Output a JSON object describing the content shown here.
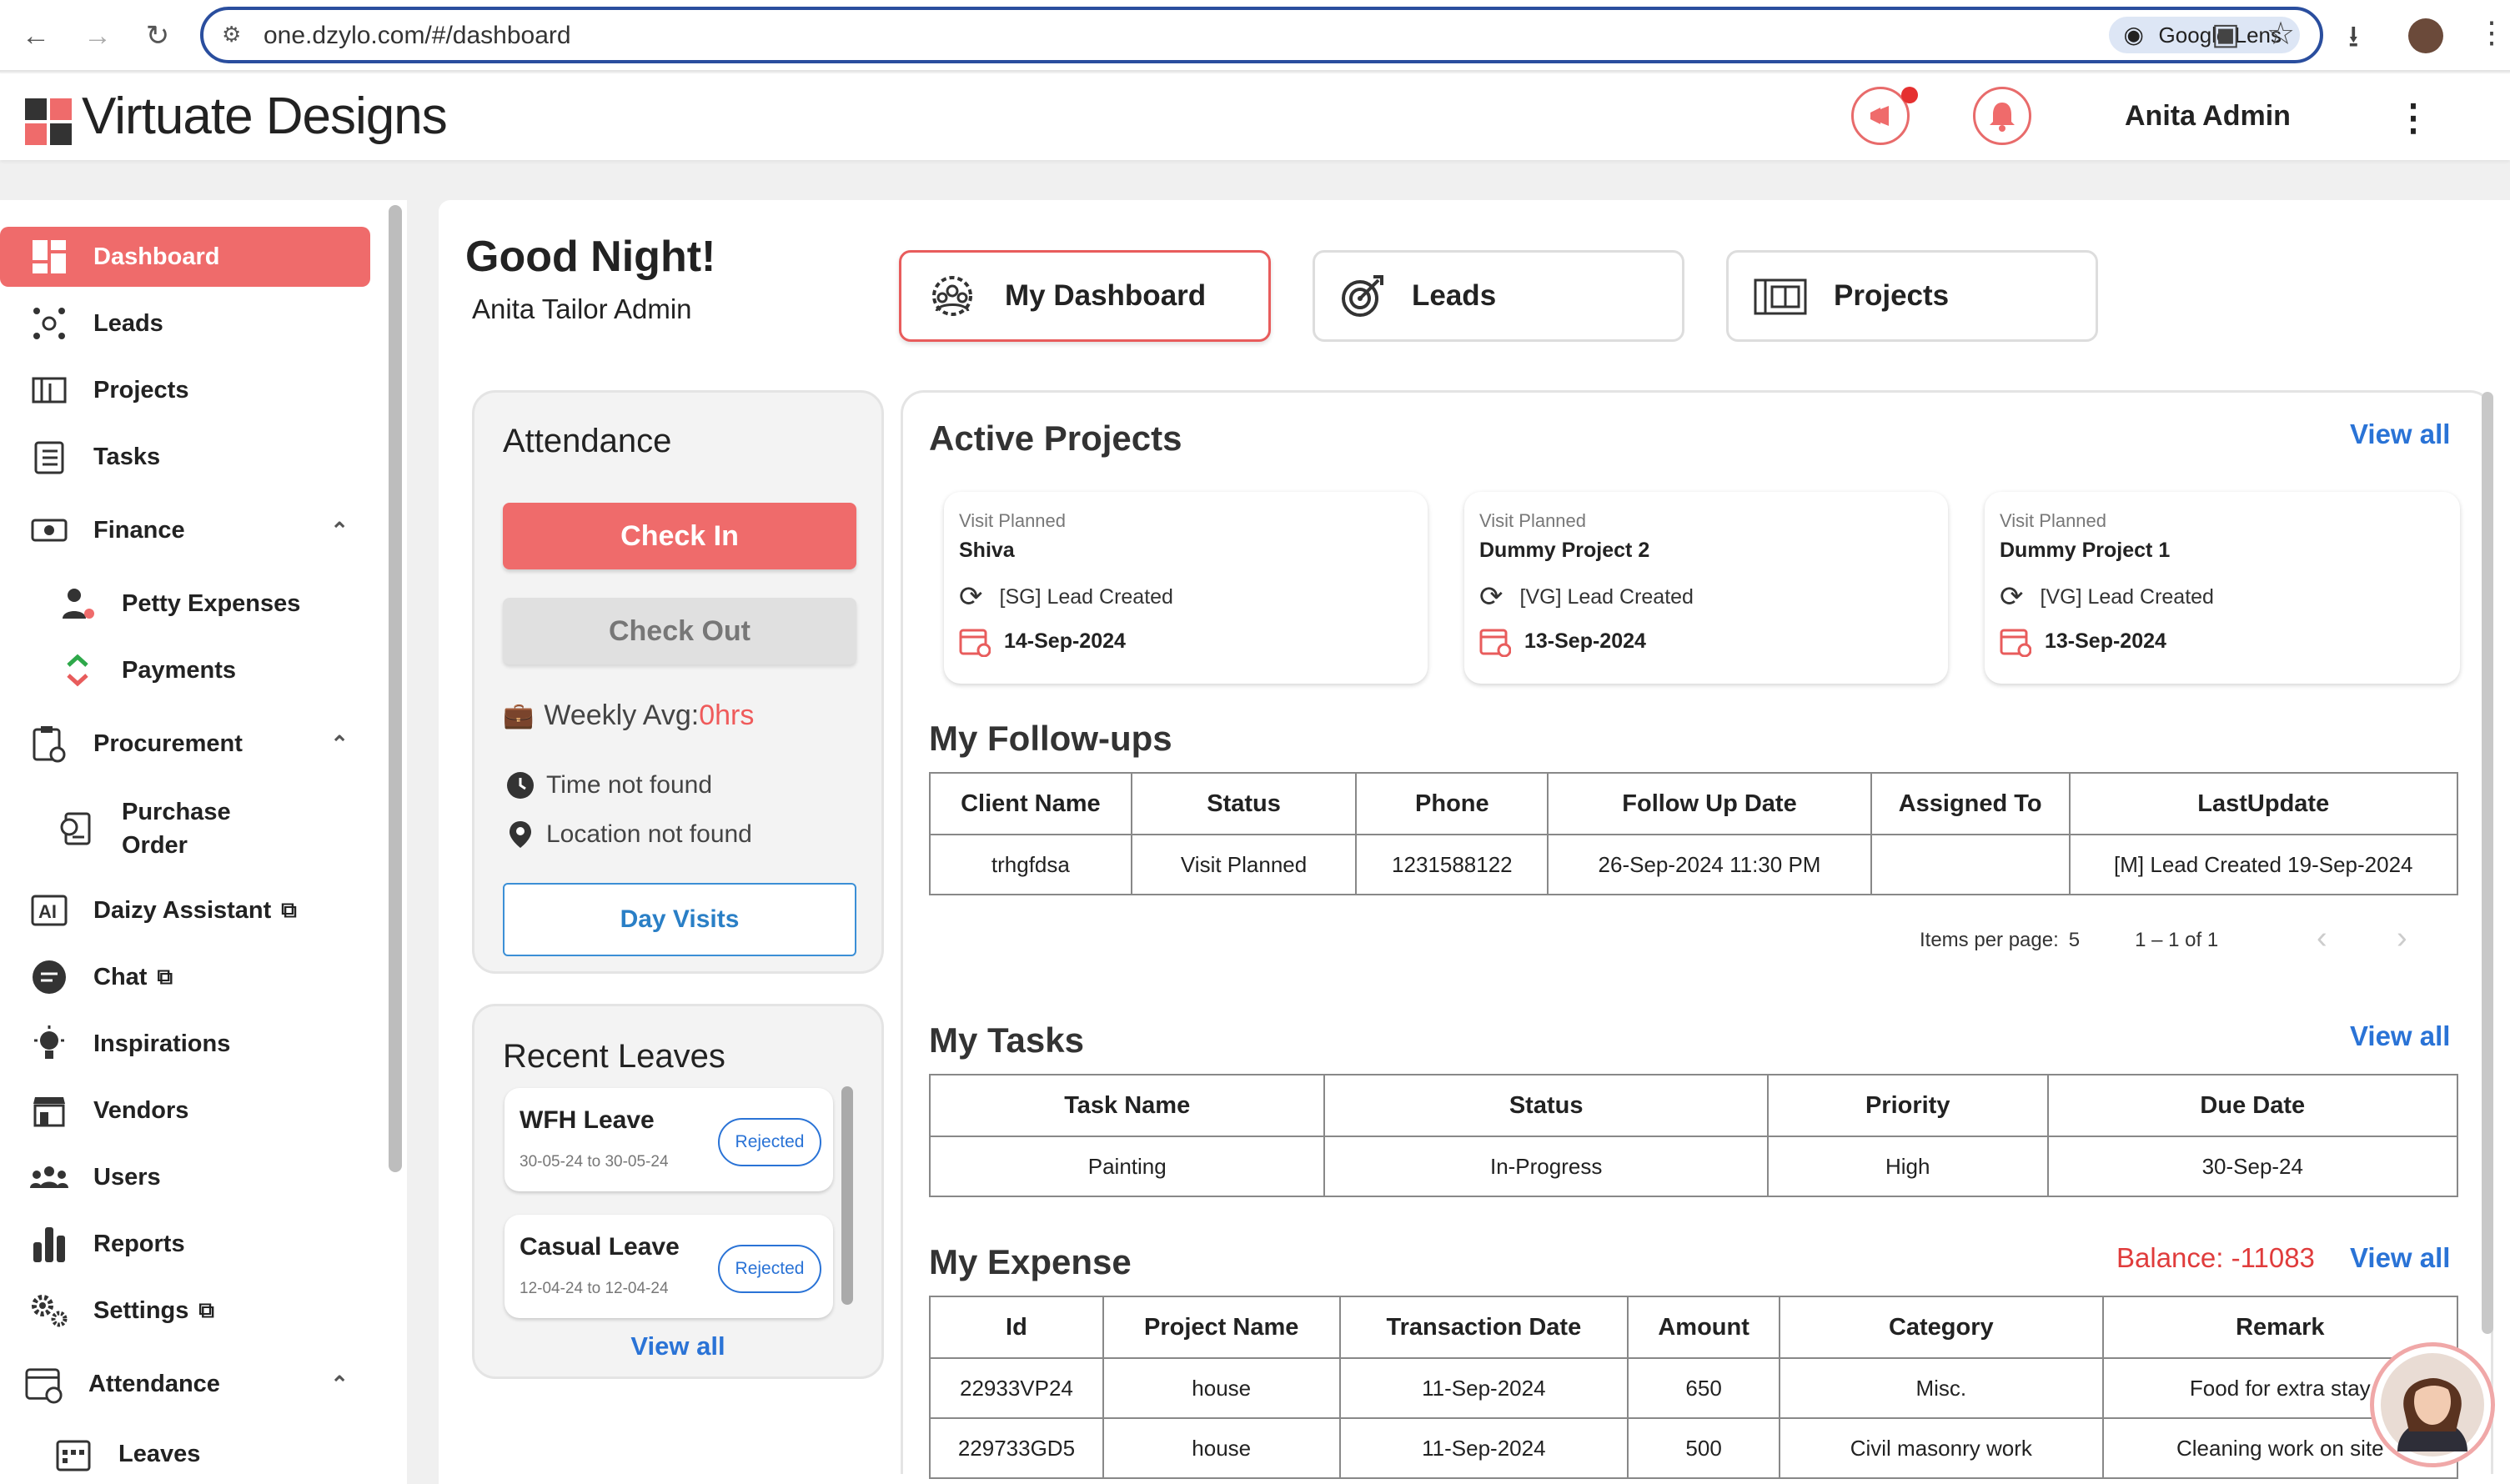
{
  "browser": {
    "url": "one.dzylo.com/#/dashboard",
    "lens_label": "Google Lens"
  },
  "app": {
    "brand": "Virtuate Designs",
    "user_name": "Anita Admin"
  },
  "sidebar": {
    "items": [
      {
        "label": "Dashboard"
      },
      {
        "label": "Leads"
      },
      {
        "label": "Projects"
      },
      {
        "label": "Tasks"
      },
      {
        "label": "Finance"
      },
      {
        "label": "Petty Expenses"
      },
      {
        "label": "Payments"
      },
      {
        "label": "Procurement"
      },
      {
        "label": "Purchase Order"
      },
      {
        "label": "Daizy Assistant"
      },
      {
        "label": "Chat"
      },
      {
        "label": "Inspirations"
      },
      {
        "label": "Vendors"
      },
      {
        "label": "Users"
      },
      {
        "label": "Reports"
      },
      {
        "label": "Settings"
      },
      {
        "label": "Attendance"
      },
      {
        "label": "Leaves"
      }
    ]
  },
  "greeting": {
    "title": "Good Night!",
    "subtitle": "Anita Tailor Admin"
  },
  "tabs": [
    {
      "label": "My Dashboard"
    },
    {
      "label": "Leads"
    },
    {
      "label": "Projects"
    }
  ],
  "attendance": {
    "title": "Attendance",
    "check_in": "Check In",
    "check_out": "Check Out",
    "weekly_label": "Weekly Avg: ",
    "weekly_value": "0hrs",
    "time_status": "Time not found",
    "location_status": "Location not found",
    "day_visits": "Day Visits"
  },
  "recent_leaves": {
    "title": "Recent Leaves",
    "items": [
      {
        "type": "WFH Leave",
        "dates": "30-05-24 to 30-05-24",
        "status": "Rejected"
      },
      {
        "type": "Casual Leave",
        "dates": "12-04-24 to 12-04-24",
        "status": "Rejected"
      }
    ],
    "view_all": "View all"
  },
  "active_projects": {
    "title": "Active Projects",
    "view_all": "View all",
    "items": [
      {
        "status": "Visit Planned",
        "name": "Shiva",
        "update": "[SG] Lead Created",
        "date": "14-Sep-2024"
      },
      {
        "status": "Visit Planned",
        "name": "Dummy Project 2",
        "update": "[VG] Lead Created",
        "date": "13-Sep-2024"
      },
      {
        "status": "Visit Planned",
        "name": "Dummy Project 1",
        "update": "[VG] Lead Created",
        "date": "13-Sep-2024"
      }
    ]
  },
  "followups": {
    "title": "My Follow-ups",
    "columns": [
      "Client Name",
      "Status",
      "Phone",
      "Follow Up Date",
      "Assigned To",
      "LastUpdate"
    ],
    "rows": [
      [
        "trhgfdsa",
        "Visit Planned",
        "1231588122",
        "26-Sep-2024 11:30 PM",
        "",
        "[M]  Lead Created 19-Sep-2024"
      ]
    ],
    "items_per_page_label": "Items per page:",
    "items_per_page": "5",
    "range": "1 – 1 of 1"
  },
  "tasks": {
    "title": "My Tasks",
    "view_all": "View all",
    "columns": [
      "Task Name",
      "Status",
      "Priority",
      "Due Date"
    ],
    "rows": [
      [
        "Painting",
        "In-Progress",
        "High",
        "30-Sep-24"
      ]
    ]
  },
  "expense": {
    "title": "My Expense",
    "balance": "Balance: -11083",
    "view_all": "View all",
    "columns": [
      "Id",
      "Project Name",
      "Transaction Date",
      "Amount",
      "Category",
      "Remark"
    ],
    "rows": [
      [
        "22933VP24",
        "house",
        "11-Sep-2024",
        "650",
        "Misc.",
        "Food for extra stay"
      ],
      [
        "229733GD5",
        "house",
        "11-Sep-2024",
        "500",
        "Civil masonry work",
        "Cleaning work on site"
      ]
    ]
  },
  "colors": {
    "accent": "#ef6b6b",
    "link": "#2a73d6",
    "balance": "#e03c3c"
  }
}
